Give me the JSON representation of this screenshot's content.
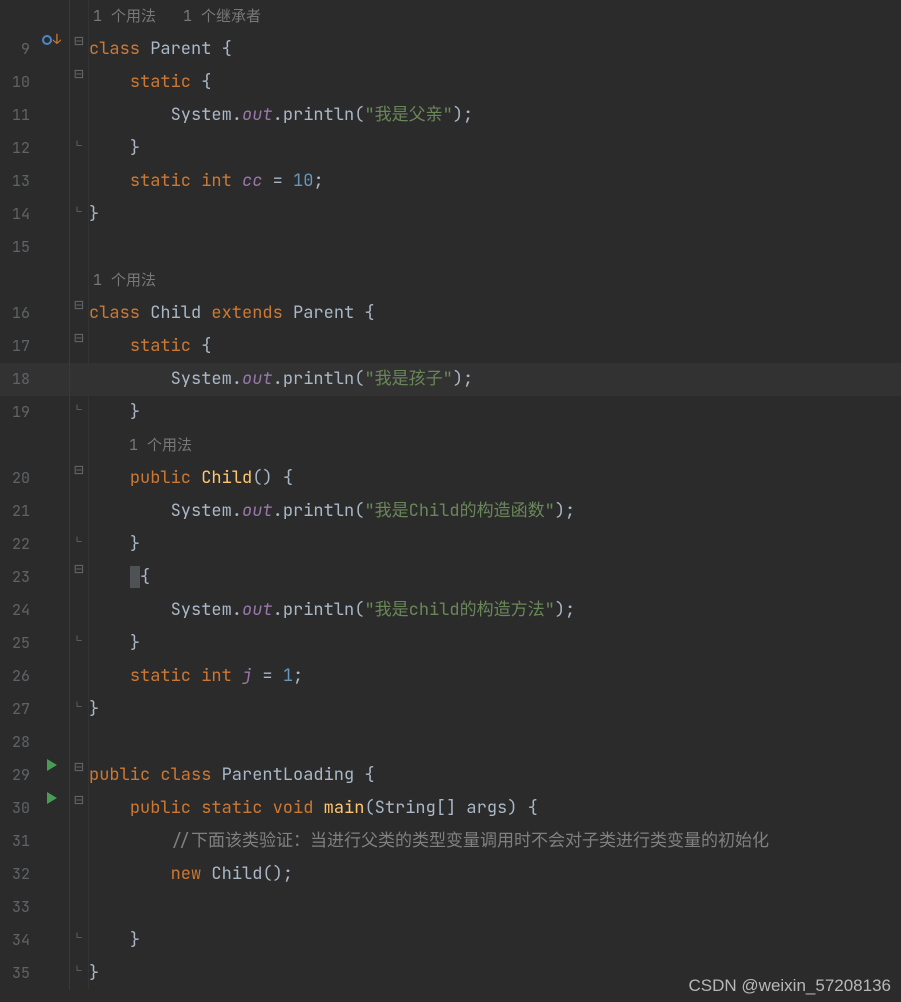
{
  "hints": {
    "usage_1_impl_1": "1 个用法   1 个继承者",
    "usage_1": "1 个用法"
  },
  "watermark": "CSDN @weixin_57208136",
  "lines": [
    {
      "num": "",
      "fold": "",
      "hint": "usage_1_impl_1",
      "tokens": []
    },
    {
      "num": "9",
      "fold": "⊟",
      "icons": "impl",
      "tokens": [
        [
          "kw",
          "class "
        ],
        [
          "cls",
          "Parent "
        ],
        [
          "par",
          "{"
        ]
      ]
    },
    {
      "num": "10",
      "fold": "⊟",
      "tokens": [
        [
          "",
          "    "
        ],
        [
          "kw",
          "static "
        ],
        [
          "par",
          "{"
        ]
      ]
    },
    {
      "num": "11",
      "fold": "",
      "tokens": [
        [
          "",
          "        "
        ],
        [
          "cls",
          "System."
        ],
        [
          "it",
          "out"
        ],
        [
          "cls",
          ".println("
        ],
        [
          "str",
          "\"我是父亲\""
        ],
        [
          "cls",
          ")"
        ],
        [
          "par",
          ";"
        ]
      ]
    },
    {
      "num": "12",
      "fold": "⊟c",
      "tokens": [
        [
          "",
          "    "
        ],
        [
          "par",
          "}"
        ]
      ]
    },
    {
      "num": "13",
      "fold": "",
      "tokens": [
        [
          "",
          "    "
        ],
        [
          "kw",
          "static int "
        ],
        [
          "it",
          "cc"
        ],
        [
          "cls",
          " = "
        ],
        [
          "num",
          "10"
        ],
        [
          "par",
          ";"
        ]
      ]
    },
    {
      "num": "14",
      "fold": "⊟c",
      "tokens": [
        [
          "par",
          "}"
        ]
      ]
    },
    {
      "num": "15",
      "fold": "",
      "tokens": []
    },
    {
      "num": "",
      "fold": "",
      "hint": "usage_1",
      "tokens": []
    },
    {
      "num": "16",
      "fold": "⊟",
      "tokens": [
        [
          "kw",
          "class "
        ],
        [
          "cls",
          "Child "
        ],
        [
          "kw",
          "extends "
        ],
        [
          "cls",
          "Parent "
        ],
        [
          "par",
          "{"
        ]
      ]
    },
    {
      "num": "17",
      "fold": "⊟",
      "tokens": [
        [
          "",
          "    "
        ],
        [
          "kw",
          "static "
        ],
        [
          "par",
          "{"
        ]
      ]
    },
    {
      "num": "18",
      "fold": "",
      "current": true,
      "tokens": [
        [
          "",
          "        "
        ],
        [
          "cls",
          "System."
        ],
        [
          "it",
          "out"
        ],
        [
          "cls",
          ".println("
        ],
        [
          "str",
          "\"我是孩子\""
        ],
        [
          "cls",
          ")"
        ],
        [
          "par",
          ";"
        ]
      ]
    },
    {
      "num": "19",
      "fold": "⊟c",
      "tokens": [
        [
          "",
          "    "
        ],
        [
          "par",
          "}"
        ]
      ]
    },
    {
      "num": "",
      "fold": "",
      "hint": "usage_1",
      "hintPad": "    ",
      "tokens": []
    },
    {
      "num": "20",
      "fold": "⊟",
      "tokens": [
        [
          "",
          "    "
        ],
        [
          "kw",
          "public "
        ],
        [
          "mth",
          "Child"
        ],
        [
          "cls",
          "() "
        ],
        [
          "par",
          "{"
        ]
      ]
    },
    {
      "num": "21",
      "fold": "",
      "tokens": [
        [
          "",
          "        "
        ],
        [
          "cls",
          "System."
        ],
        [
          "it",
          "out"
        ],
        [
          "cls",
          ".println("
        ],
        [
          "str",
          "\"我是Child的构造函数\""
        ],
        [
          "cls",
          ")"
        ],
        [
          "par",
          ";"
        ]
      ]
    },
    {
      "num": "22",
      "fold": "⊟c",
      "tokens": [
        [
          "",
          "    "
        ],
        [
          "par",
          "}"
        ]
      ]
    },
    {
      "num": "23",
      "fold": "⊟",
      "tokens": [
        [
          "",
          "    "
        ],
        [
          "caret",
          ""
        ],
        [
          "par",
          "{"
        ]
      ]
    },
    {
      "num": "24",
      "fold": "",
      "tokens": [
        [
          "",
          "        "
        ],
        [
          "cls",
          "System."
        ],
        [
          "it",
          "out"
        ],
        [
          "cls",
          ".println("
        ],
        [
          "str",
          "\"我是child的构造方法\""
        ],
        [
          "cls",
          ")"
        ],
        [
          "par",
          ";"
        ]
      ]
    },
    {
      "num": "25",
      "fold": "⊟c",
      "tokens": [
        [
          "",
          "    "
        ],
        [
          "par",
          "}"
        ]
      ]
    },
    {
      "num": "26",
      "fold": "",
      "tokens": [
        [
          "",
          "    "
        ],
        [
          "kw",
          "static int "
        ],
        [
          "it",
          "j"
        ],
        [
          "cls",
          " = "
        ],
        [
          "num",
          "1"
        ],
        [
          "par",
          ";"
        ]
      ]
    },
    {
      "num": "27",
      "fold": "⊟c",
      "tokens": [
        [
          "par",
          "}"
        ]
      ]
    },
    {
      "num": "28",
      "fold": "",
      "tokens": []
    },
    {
      "num": "29",
      "fold": "⊟",
      "icons": "run",
      "tokens": [
        [
          "kw",
          "public class "
        ],
        [
          "cls",
          "ParentLoading "
        ],
        [
          "par",
          "{"
        ]
      ]
    },
    {
      "num": "30",
      "fold": "⊟",
      "icons": "run",
      "tokens": [
        [
          "",
          "    "
        ],
        [
          "kw",
          "public static void "
        ],
        [
          "mth",
          "main"
        ],
        [
          "cls",
          "(String[] args) "
        ],
        [
          "par",
          "{"
        ]
      ]
    },
    {
      "num": "31",
      "fold": "",
      "tokens": [
        [
          "",
          "        "
        ],
        [
          "cmt",
          "//下面该类验证：当进行父类的类型变量调用时不会对子类进行类变量的初始化"
        ]
      ]
    },
    {
      "num": "32",
      "fold": "",
      "tokens": [
        [
          "",
          "        "
        ],
        [
          "kw",
          "new "
        ],
        [
          "cls",
          "Child()"
        ],
        [
          "par",
          ";"
        ]
      ]
    },
    {
      "num": "33",
      "fold": "",
      "tokens": []
    },
    {
      "num": "34",
      "fold": "⊟c",
      "tokens": [
        [
          "",
          "    "
        ],
        [
          "par",
          "}"
        ]
      ]
    },
    {
      "num": "35",
      "fold": "⊟c",
      "tokens": [
        [
          "par",
          "}"
        ]
      ]
    }
  ]
}
